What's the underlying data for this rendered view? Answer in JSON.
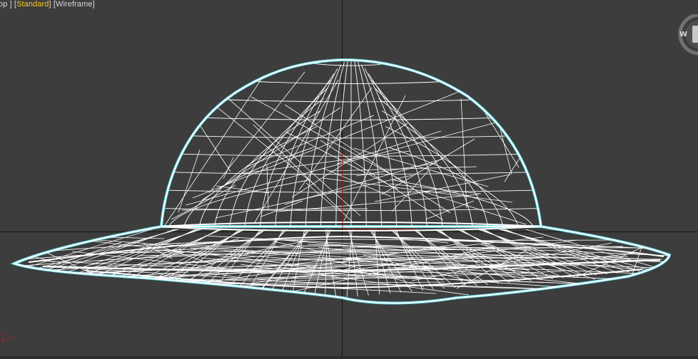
{
  "viewport": {
    "label_prefix": "op ]",
    "shading_mode": "Standard",
    "display_mode": "Wireframe",
    "bracket_open": "[",
    "bracket_close": "]"
  },
  "viewcube": {
    "compass_letter": "W"
  },
  "colors": {
    "background": "#3d3d3d",
    "wire": "#ffffff",
    "selection_outline": "#5fd8e8",
    "active_label": "#ffc61a",
    "grid_line": "#141414",
    "pivot_x": "#b02020",
    "pivot_y": "#b02020"
  },
  "icons": {
    "viewcube": "viewcube-icon",
    "pivot": "pivot-gizmo-icon",
    "world_axis": "world-axis-icon"
  }
}
